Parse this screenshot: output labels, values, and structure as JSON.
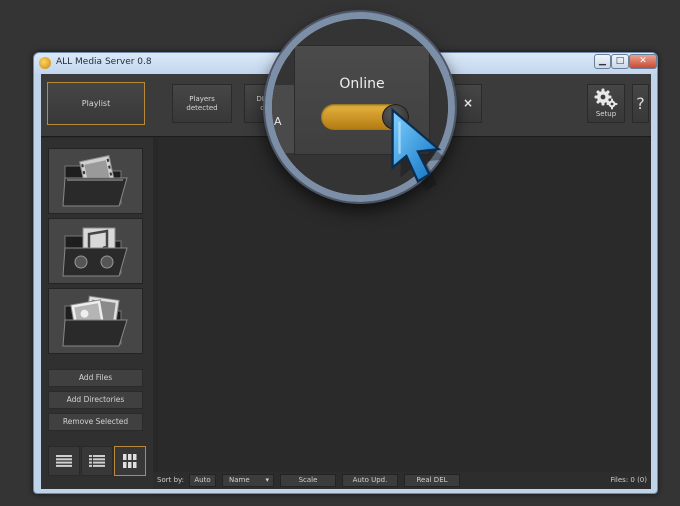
{
  "window": {
    "title": "ALL Media Server 0.8",
    "minimize_glyph": "▁",
    "maximize_glyph": "□",
    "close_glyph": "✕"
  },
  "toolbar": {
    "playlist_label": "Playlist",
    "players_label_line1": "Players",
    "players_label_line2": "detected",
    "dlna_label_line1": "DLNA",
    "dlna_label_line2": "det",
    "close_glyph": "×",
    "setup_label": "Setup",
    "help_label": "?"
  },
  "magnifier": {
    "online_label": "Online",
    "toggle_state": "on",
    "left_fragment": "A"
  },
  "library": {
    "items": [
      {
        "name": "video-folder-icon"
      },
      {
        "name": "music-folder-icon"
      },
      {
        "name": "photo-folder-icon"
      }
    ],
    "add_files_label": "Add Files",
    "add_dirs_label": "Add Directories",
    "remove_selected_label": "Remove Selected",
    "view_modes": [
      "details",
      "list",
      "grid"
    ],
    "active_view": "grid"
  },
  "statusbar": {
    "sort_by_label": "Sort by:",
    "sort_auto_label": "Auto",
    "sort_name_label": "Name",
    "scale_label": "Scale",
    "auto_upd_label": "Auto Upd.",
    "real_del_label": "Real DEL",
    "files_count": "Files: 0 (0)"
  },
  "colors": {
    "accent_orange": "#b88a39",
    "toggle_gold": "#e7b43f",
    "cursor_blue": "#2a9fe8"
  }
}
